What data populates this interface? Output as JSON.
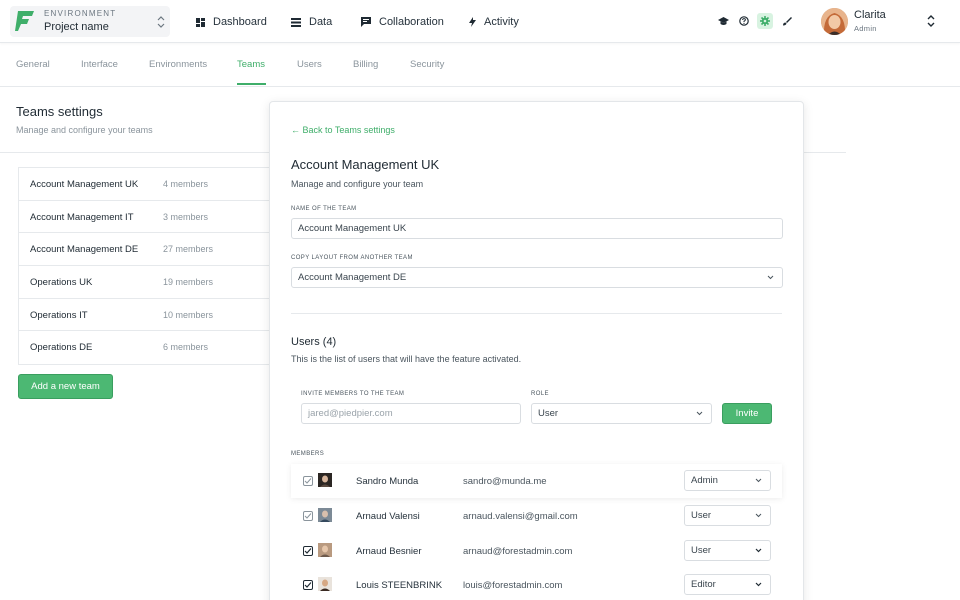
{
  "colors": {
    "accent": "#3fae6a",
    "button": "#4cb873"
  },
  "header": {
    "env_label": "ENVIRONMENT",
    "env_value": "Project name",
    "nav": [
      {
        "label": "Dashboard",
        "icon": "dashboard-icon"
      },
      {
        "label": "Data",
        "icon": "data-icon"
      },
      {
        "label": "Collaboration",
        "icon": "chat-icon"
      },
      {
        "label": "Activity",
        "icon": "lightning-icon"
      }
    ],
    "user": {
      "name": "Clarita",
      "role": "Admin"
    }
  },
  "tabs": [
    "General",
    "Interface",
    "Environments",
    "Teams",
    "Users",
    "Billing",
    "Security"
  ],
  "active_tab": "Teams",
  "left": {
    "title": "Teams settings",
    "subtitle": "Manage and configure your teams",
    "teams": [
      {
        "name": "Account Management UK",
        "count": "4 members"
      },
      {
        "name": "Account Management IT",
        "count": "3 members"
      },
      {
        "name": "Account Management DE",
        "count": "27 members"
      },
      {
        "name": "Operations UK",
        "count": "19 members"
      },
      {
        "name": "Operations IT",
        "count": "10 members"
      },
      {
        "name": "Operations DE",
        "count": "6 members"
      }
    ],
    "add_button": "Add a new team"
  },
  "detail": {
    "back": "← Back to Teams settings",
    "title": "Account Management UK",
    "subtitle": "Manage and configure your team",
    "name_label": "NAME OF THE TEAM",
    "name_value": "Account Management UK",
    "copy_label": "COPY LAYOUT FROM ANOTHER TEAM",
    "copy_value": "Account Management DE",
    "users_title": "Users (4)",
    "users_sub": "This is the list of users that will have the feature activated.",
    "invite_label": "INVITE MEMBERS TO THE TEAM",
    "invite_placeholder": "jared@piedpier.com",
    "role_label": "ROLE",
    "role_value": "User",
    "invite_button": "Invite",
    "members_label": "MEMBERS",
    "members": [
      {
        "name": "Sandro Munda",
        "email": "sandro@munda.me",
        "role": "Admin"
      },
      {
        "name": "Arnaud Valensi",
        "email": "arnaud.valensi@gmail.com",
        "role": "User"
      },
      {
        "name": "Arnaud Besnier",
        "email": "arnaud@forestadmin.com",
        "role": "User"
      },
      {
        "name": "Louis STEENBRINK",
        "email": "louis@forestadmin.com",
        "role": "Editor"
      }
    ]
  }
}
